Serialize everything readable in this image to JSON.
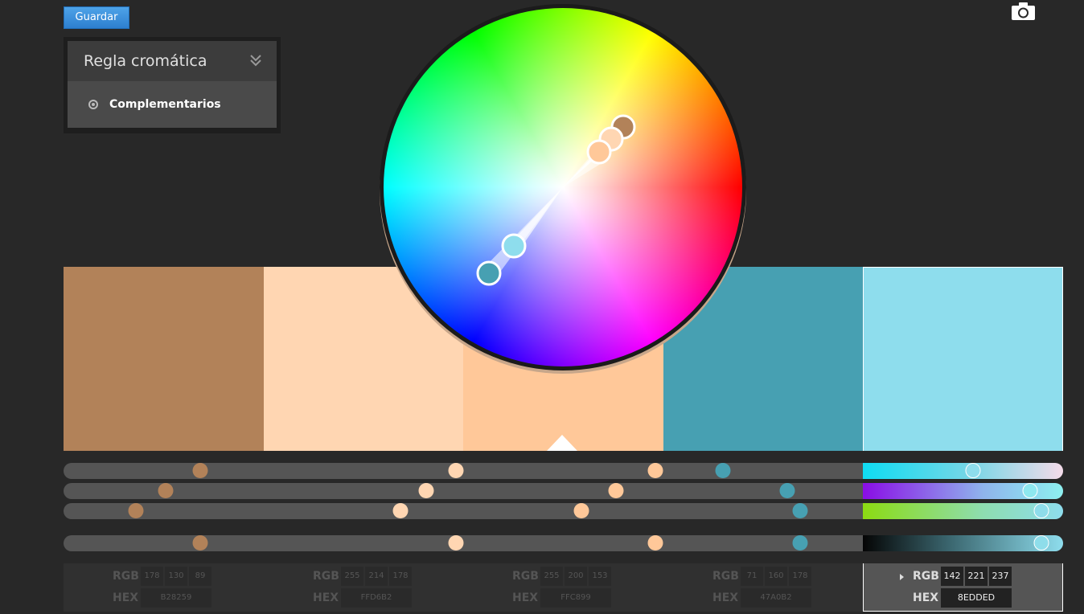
{
  "toolbar": {
    "save_label": "Guardar",
    "camera_icon": "camera-icon"
  },
  "rule": {
    "title": "Regla cromática",
    "selected": "Complementarios"
  },
  "colors": {
    "c1": "#B28259",
    "c2": "#FFD6B2",
    "c3": "#FFC899",
    "c4": "#47A0B2",
    "c5": "#8EDDED",
    "track": "#555555",
    "accent": "#2D7FCF"
  },
  "swatches": [
    {
      "rgb": [
        "178",
        "130",
        "89"
      ],
      "hex": "B28259"
    },
    {
      "rgb": [
        "255",
        "214",
        "178"
      ],
      "hex": "FFD6B2"
    },
    {
      "rgb": [
        "255",
        "200",
        "153"
      ],
      "hex": "FFC899"
    },
    {
      "rgb": [
        "71",
        "160",
        "178"
      ],
      "hex": "47A0B2"
    },
    {
      "rgb": [
        "142",
        "221",
        "237"
      ],
      "hex": "8EDDED"
    }
  ],
  "selected_index": 4,
  "labels": {
    "rgb": "RGB",
    "hex": "HEX"
  }
}
